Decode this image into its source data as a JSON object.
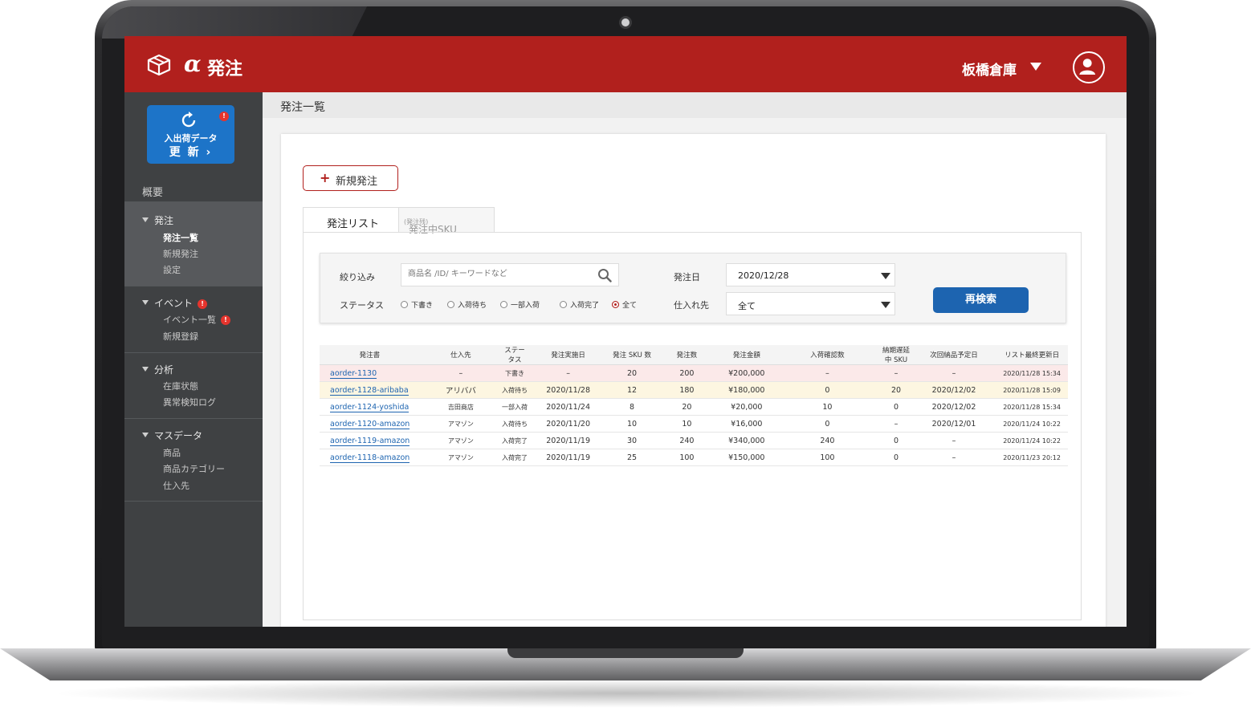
{
  "app": {
    "logo_alpha": "α",
    "logo_text": "発注",
    "warehouse": "板橋倉庫"
  },
  "sidebar": {
    "refresh_label1": "入出荷データ",
    "refresh_label2": "更 新 ›",
    "refresh_alert": "!",
    "overview": "概要",
    "groups": [
      {
        "label": "発注",
        "items": [
          "発注一覧",
          "新規発注",
          "設定"
        ]
      },
      {
        "label": "イベント",
        "badge": "!",
        "items": [
          {
            "label": "イベント一覧",
            "badge": "!"
          },
          {
            "label": "新規登録"
          }
        ]
      },
      {
        "label": "分析",
        "items": [
          "在庫状態",
          "異常検知ログ"
        ]
      },
      {
        "label": "マスデータ",
        "items": [
          "商品",
          "商品カテゴリー",
          "仕入先"
        ]
      }
    ]
  },
  "page": {
    "title": "発注一覧"
  },
  "actions": {
    "new_order": "新規発注",
    "new_order_icon": "+"
  },
  "tabs": [
    {
      "label": "発注リスト",
      "active": true
    },
    {
      "label": "発注中SKU",
      "sub": "(発注残)",
      "active": false
    }
  ],
  "filter": {
    "narrow_label": "絞り込み",
    "search_placeholder": "商品名 /ID/ キーワードなど",
    "status_label": "ステータス",
    "statuses": [
      "下書き",
      "入荷待ち",
      "一部入荷",
      "入荷完了",
      "全て"
    ],
    "selected_status": "全て",
    "date_label": "発注日",
    "date_value": "2020/12/28",
    "supplier_label": "仕入れ先",
    "supplier_value": "全て",
    "search_button": "再検索"
  },
  "table": {
    "headers": [
      "発注書",
      "仕入先",
      "ステータス",
      "発注実施日",
      "発注 SKU 数",
      "発注数",
      "発注金額",
      "入荷確認数",
      "納期遅延中 SKU",
      "次回納品予定日",
      "リスト最終更新日"
    ],
    "rows": [
      [
        "aorder-1130",
        "–",
        "下書き",
        "–",
        "20",
        "200",
        "¥200,000",
        "–",
        "–",
        "–",
        "2020/11/28 15:34"
      ],
      [
        "aorder-1128-aribaba",
        "アリババ",
        "入荷待ち",
        "2020/11/28",
        "12",
        "180",
        "¥180,000",
        "0",
        "20",
        "2020/12/02",
        "2020/11/28 15:09"
      ],
      [
        "aorder-1124-yoshida",
        "吉田商店",
        "一部入荷",
        "2020/11/24",
        "8",
        "20",
        "¥20,000",
        "10",
        "0",
        "2020/12/02",
        "2020/11/28 15:34"
      ],
      [
        "aorder-1120-amazon",
        "アマゾン",
        "入荷待ち",
        "2020/11/20",
        "10",
        "10",
        "¥16,000",
        "0",
        "–",
        "2020/12/01",
        "2020/11/24 10:22"
      ],
      [
        "aorder-1119-amazon",
        "アマゾン",
        "入荷完了",
        "2020/11/19",
        "30",
        "240",
        "¥340,000",
        "240",
        "0",
        "–",
        "2020/11/24 10:22"
      ],
      [
        "aorder-1118-amazon",
        "アマゾン",
        "入荷完了",
        "2020/11/19",
        "25",
        "100",
        "¥150,000",
        "100",
        "0",
        "–",
        "2020/11/23 20:12"
      ]
    ]
  },
  "colors": {
    "brand": "#b1201d",
    "primary": "#1d64b0",
    "sidebar": "#3f4143",
    "row_draft": "#fbe9e9",
    "row_waiting": "#fdf6e1"
  },
  "icons": {
    "logo": "box-icon",
    "refresh": "refresh-icon",
    "caret": "caret-down-icon",
    "user": "user-icon",
    "search": "search-icon"
  }
}
